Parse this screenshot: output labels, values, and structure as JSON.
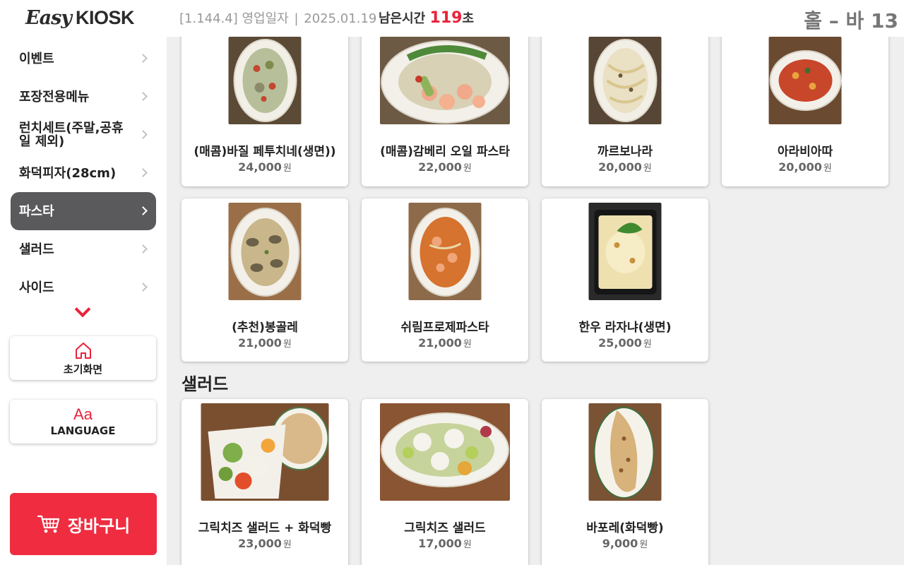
{
  "logo": {
    "easy": "Easy",
    "kiosk": "KIOSK"
  },
  "header": {
    "version": "[1.144.4]",
    "business_day_label": "영업일자",
    "separator": "|",
    "business_date": "2025.01.19",
    "remaining_label": "남은시간",
    "remaining_value": "119",
    "remaining_unit": "초",
    "table_label": "홀 – 바 13"
  },
  "sidebar": {
    "items": [
      {
        "label": "이벤트"
      },
      {
        "label": "포장전용메뉴"
      },
      {
        "label": "런치세트(주말,공휴일 제외)"
      },
      {
        "label": "화덕피자(28cm)"
      },
      {
        "label": "파스타"
      },
      {
        "label": "샐러드"
      },
      {
        "label": "사이드"
      }
    ],
    "active_index": 4,
    "home_label": "초기화면",
    "language_icon": "Aa",
    "language_label": "LANGUAGE",
    "cart_label": "장바구니"
  },
  "currency_unit": "원",
  "pasta_items": [
    {
      "name": "(매콤)바질 페투치네(생면))",
      "price": "24,000"
    },
    {
      "name": "(매콤)감베리 오일 파스타",
      "price": "22,000"
    },
    {
      "name": "까르보나라",
      "price": "20,000"
    },
    {
      "name": "아라비아따",
      "price": "20,000"
    },
    {
      "name": "(추천)봉골레",
      "price": "21,000"
    },
    {
      "name": "쉬림프로제파스타",
      "price": "21,000"
    },
    {
      "name": "한우 라자냐(생면)",
      "price": "25,000"
    }
  ],
  "salad_section_title": "샐러드",
  "salad_items": [
    {
      "name": "그릭치즈 샐러드 + 화덕빵",
      "price": "23,000"
    },
    {
      "name": "그릭치즈 샐러드",
      "price": "17,000"
    },
    {
      "name": "바포레(화덕빵)",
      "price": "9,000"
    }
  ],
  "colors": {
    "accent": "#ef2c40",
    "active_menu": "#5a5a5c"
  }
}
